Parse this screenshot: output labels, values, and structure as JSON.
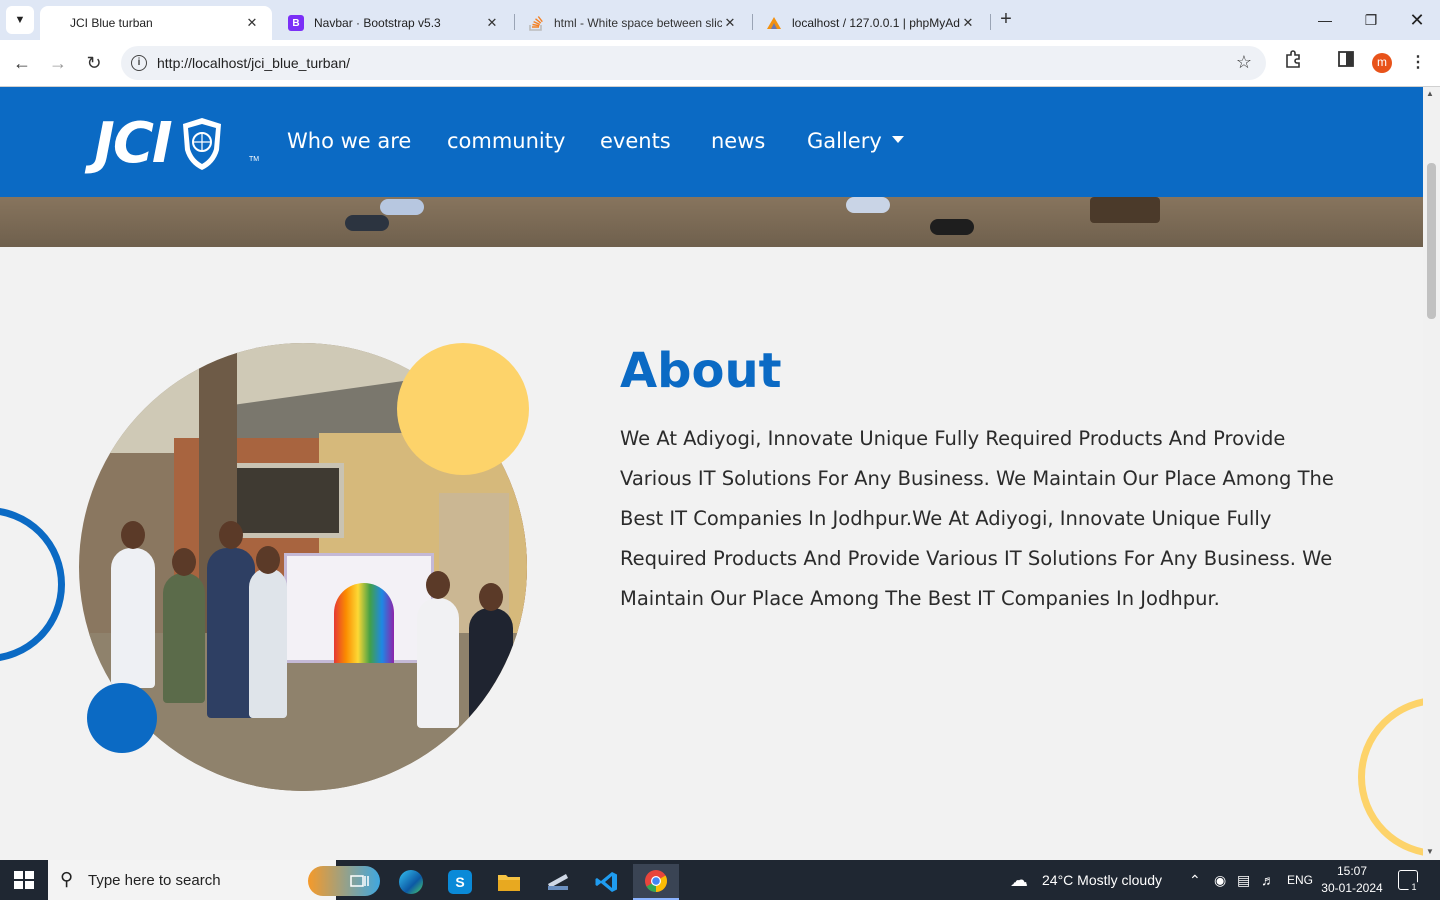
{
  "browser": {
    "tabs": [
      {
        "title": "JCI Blue turban",
        "favicon": "jci-favicon",
        "active": true
      },
      {
        "title": "Navbar · Bootstrap v5.3",
        "favicon": "bootstrap-icon",
        "favicon_text": "B"
      },
      {
        "title": "html - White space between slic",
        "favicon": "stackoverflow-icon"
      },
      {
        "title": "localhost / 127.0.0.1 | phpMyAd",
        "favicon": "phpmyadmin-icon"
      }
    ],
    "new_tab": "+",
    "address": "http://localhost/jci_blue_turban/",
    "profile_initial": "m"
  },
  "site": {
    "logo": "JCI",
    "logo_tm": "TM",
    "nav": [
      {
        "label": "Who we are"
      },
      {
        "label": "community"
      },
      {
        "label": "events"
      },
      {
        "label": "news"
      },
      {
        "label": "Gallery"
      }
    ]
  },
  "about": {
    "title": "About",
    "body": "We At Adiyogi, Innovate Unique Fully Required Products And Provide Various IT Solutions For Any Business. We Maintain Our Place Among The Best IT Companies In Jodhpur.We At Adiyogi, Innovate Unique Fully Required Products And Provide Various IT Solutions For Any Business. We Maintain Our Place Among The Best IT Companies In Jodhpur."
  },
  "colors": {
    "brand_blue": "#0b6ac4",
    "accent_yellow": "#fdd36a"
  },
  "taskbar": {
    "search_placeholder": "Type here to search",
    "weather": "24°C  Mostly cloudy",
    "language": "ENG",
    "time": "15:07",
    "date": "30-01-2024",
    "notification_count": "1"
  }
}
